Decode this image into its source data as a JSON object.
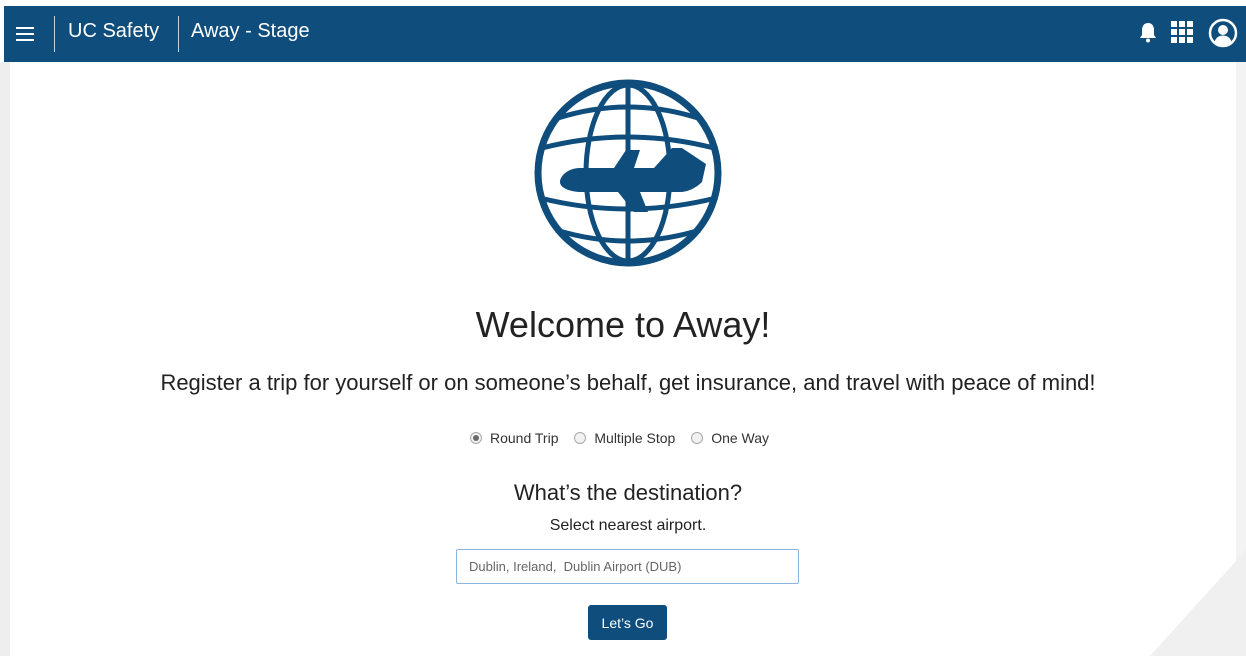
{
  "header": {
    "brand": "UC Safety",
    "app_name": "Away - Stage",
    "icons": [
      "menu-icon",
      "bell-icon",
      "apps-grid-icon",
      "account-icon"
    ],
    "background_color": "#0e4d7c"
  },
  "hero": {
    "logo": "globe-airplane-logo",
    "title": "Welcome to Away!",
    "subtitle": "Register a trip for yourself or on someone’s behalf, get insurance, and travel with peace of mind!"
  },
  "trip_types": {
    "selected": "Round Trip",
    "options": [
      {
        "label": "Round Trip",
        "checked": true
      },
      {
        "label": "Multiple Stop",
        "checked": false
      },
      {
        "label": "One Way",
        "checked": false
      }
    ]
  },
  "destination": {
    "question": "What’s the destination?",
    "hint": "Select nearest airport.",
    "value": "Dublin, Ireland,  Dublin Airport (DUB)"
  },
  "actions": {
    "go_label": "Let’s Go"
  },
  "colors": {
    "primary": "#0e4d7c",
    "input_focus_border": "#8bb6e0"
  }
}
